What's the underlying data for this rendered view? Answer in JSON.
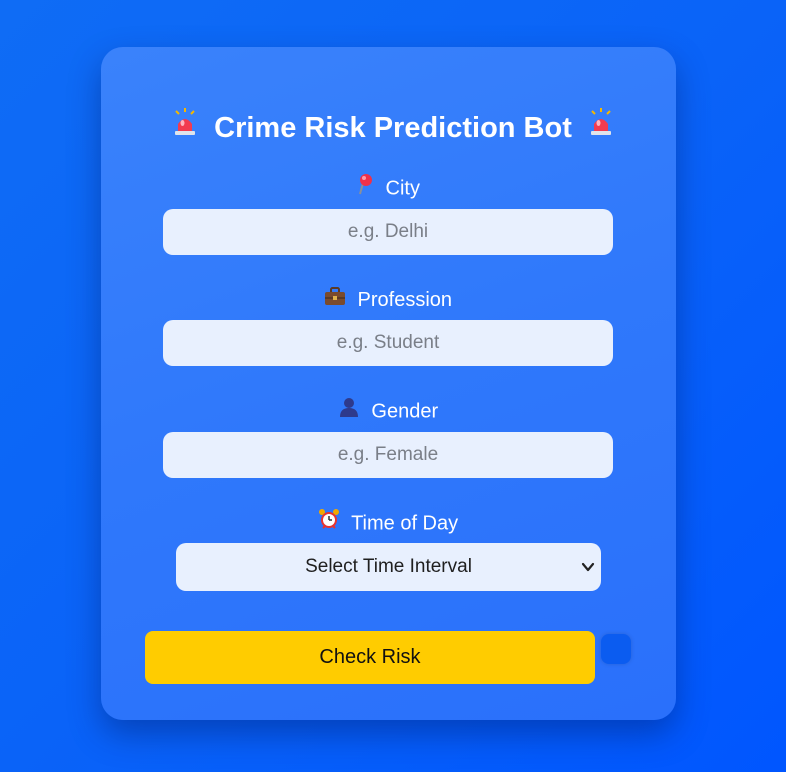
{
  "app": {
    "title": "Crime Risk Prediction Bot",
    "title_icon": "police-siren-icon"
  },
  "form": {
    "city": {
      "icon": "pin-icon",
      "label": "City",
      "placeholder": "e.g. Delhi",
      "value": ""
    },
    "profession": {
      "icon": "briefcase-icon",
      "label": "Profession",
      "placeholder": "e.g. Student",
      "value": ""
    },
    "gender": {
      "icon": "person-icon",
      "label": "Gender",
      "placeholder": "e.g. Female",
      "value": ""
    },
    "time_of_day": {
      "icon": "alarm-clock-icon",
      "label": "Time of Day",
      "selected": "Select Time Interval"
    },
    "submit_label": "Check Risk"
  },
  "colors": {
    "background": "#0a63f8",
    "card": "#3179fb",
    "input_bg": "#e8f0fe",
    "button": "#ffcc00",
    "text_light": "#ffffff"
  }
}
